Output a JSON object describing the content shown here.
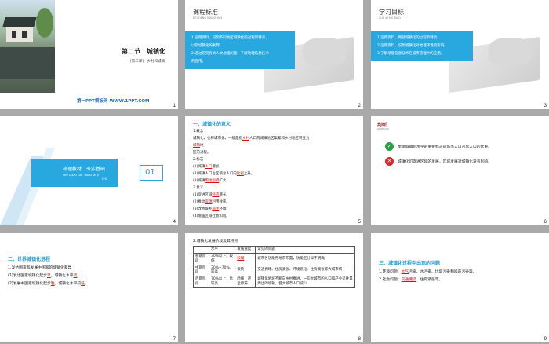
{
  "slides": {
    "s1": {
      "number": "1",
      "title": "第二节　城镇化",
      "subtitle": "[第二课]　乡村和城镇",
      "footer": "第一PPT模板网-WWW.1PPT.COM"
    },
    "s2": {
      "number": "2",
      "title": "课程标准",
      "subtitle": "KECHENG BIAOZHUN",
      "lines": [
        "1.运用资料，说明不同地区城镇化的过程和特点，",
        "以及城镇化的利弊。",
        "2.通过研究有关人文地理问题，了解地理信息技术",
        "的应用。"
      ]
    },
    "s3": {
      "number": "3",
      "title": "学习目标",
      "subtitle": "XUE XI MU BIAO",
      "lines": [
        "1.运用资料，概括城镇化的过程和特点。",
        "2.运用资料，说明城镇化对地理环境的影响。",
        "3.了解地理信息技术在城市管理中的应用。"
      ]
    },
    "s4": {
      "number": "4",
      "left_title": "梳理教材　夯实基础",
      "left_sub": "SHU LI JIAO CAI　HANG SHI JI",
      "left_sub2": "CHU",
      "badge": "01"
    },
    "s5": {
      "number": "5",
      "heading": "一、城镇化的意义",
      "lines": [
        [
          "1.概念",
          "",
          ""
        ],
        [
          "城镇化，也称城市化，一般是指",
          "乡村",
          "人口向城镇地区集聚和乡村地区转变为"
        ],
        [
          "",
          "城镇",
          "地"
        ],
        [
          "区的过程。",
          "",
          ""
        ],
        [
          "2.标志",
          "",
          ""
        ],
        [
          "(1)城镇",
          "人口",
          "增加。"
        ],
        [
          "(2)城镇人口占区域总人口的",
          "比例",
          "上升。"
        ],
        [
          "(3)城镇",
          "用地规模",
          "扩大。"
        ],
        [
          "3.意义",
          "",
          ""
        ],
        [
          "(1)促进区域",
          "经济",
          "增长。"
        ],
        [
          "(2)推动",
          "资源",
          "利用效率。"
        ],
        [
          "(3)改善城乡",
          "居住",
          "环境。"
        ],
        [
          "(4)增强区域社会和谐。",
          "",
          ""
        ]
      ]
    },
    "s6": {
      "number": "6",
      "heading": "判断",
      "heading_sub": "PANDUAN",
      "items": [
        {
          "mark": "✓",
          "text": "衡量城镇化水平的重要标志是城市人口占总人口的比重。"
        },
        {
          "mark": "✕",
          "text": "城镇化可促进区域的发展，区域发展对城镇化没有影响。"
        }
      ]
    },
    "s7": {
      "number": "7",
      "heading": "二、世界城镇化进程",
      "lines": [
        [
          "1.发达国家和发展中国家的城镇化差异",
          "",
          "",
          "",
          ""
        ],
        [
          "(1)发达国家城镇化起步",
          "早",
          "，城镇化水平",
          "高",
          "。"
        ],
        [
          "(2)发展中国家城镇化起步",
          "晚",
          "，城镇化水平较",
          "低",
          "。"
        ]
      ]
    },
    "s8": {
      "number": "8",
      "caption": "2.城镇化发展阶段及其特点",
      "headers": [
        "",
        "水平",
        "发展速度",
        "常见的问题"
      ],
      "rows": [
        [
          "初期阶段",
          "30%以下，较低",
          "较慢",
          "城市各功能用地杂布置，功能区分异不明确"
        ],
        [
          "中期阶段",
          "30%~70%，较高",
          "很快",
          "交通拥堵、住房紧张、环境恶化、住房紧张等大城市病"
        ],
        [
          "后期阶段",
          "70%以上，比较高",
          "趋缓，甚至停滞",
          "城镇化地域不断向乡村推进，一些大城市的人口和产业迁往其周边的城镇，使大城市人口减少"
        ]
      ],
      "notes": [
        "交通拥堵",
        "郊区城市化"
      ]
    },
    "s9": {
      "number": "9",
      "heading": "三、城镇化过程中出现的问题",
      "lines": [
        [
          "1.环境问题：",
          "大气",
          "污染、水污染、垃圾污染和噪声污染等。"
        ],
        [
          "2.社会问题：",
          "交通拥挤",
          "、住房紧张等。"
        ]
      ]
    }
  }
}
